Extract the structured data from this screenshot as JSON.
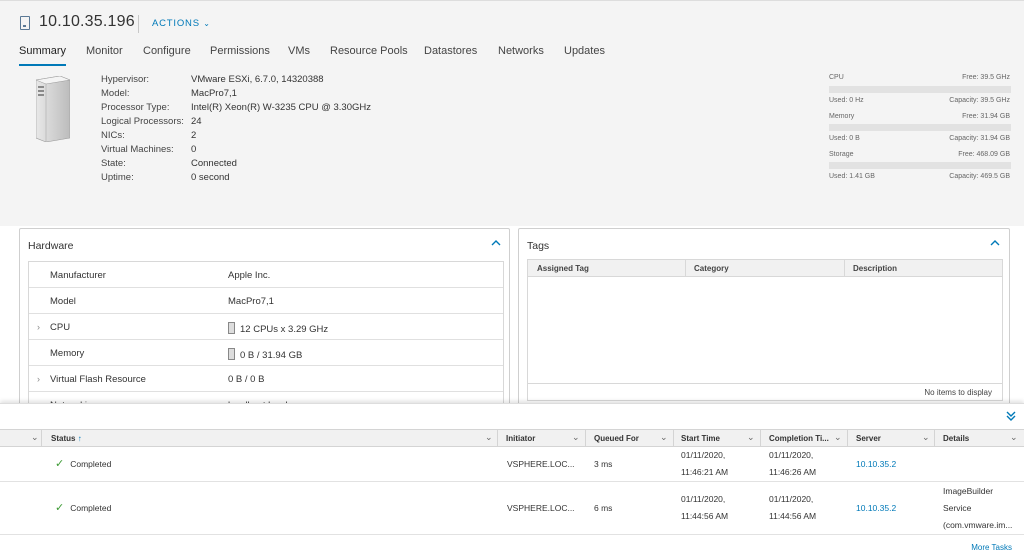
{
  "header": {
    "host_name": "10.10.35.196",
    "actions_label": "ACTIONS",
    "tabs": [
      "Summary",
      "Monitor",
      "Configure",
      "Permissions",
      "VMs",
      "Resource Pools",
      "Datastores",
      "Networks",
      "Updates"
    ],
    "active_tab": "Summary"
  },
  "summary": {
    "properties": [
      {
        "label": "Hypervisor:",
        "value": "VMware ESXi, 6.7.0, 14320388"
      },
      {
        "label": "Model:",
        "value": "MacPro7,1"
      },
      {
        "label": "Processor Type:",
        "value": "Intel(R) Xeon(R) W-3235 CPU @ 3.30GHz"
      },
      {
        "label": "Logical Processors:",
        "value": "24"
      },
      {
        "label": "NICs:",
        "value": "2"
      },
      {
        "label": "Virtual Machines:",
        "value": "0"
      },
      {
        "label": "State:",
        "value": "Connected"
      },
      {
        "label": "Uptime:",
        "value": "0 second"
      }
    ],
    "resources": [
      {
        "name": "CPU",
        "free": "Free: 39.5 GHz",
        "used": "Used: 0 Hz",
        "capacity": "Capacity: 39.5 GHz",
        "used_fraction": 0
      },
      {
        "name": "Memory",
        "free": "Free: 31.94 GB",
        "used": "Used: 0 B",
        "capacity": "Capacity: 31.94 GB",
        "used_fraction": 0
      },
      {
        "name": "Storage",
        "free": "Free: 468.09 GB",
        "used": "Used: 1.41 GB",
        "capacity": "Capacity: 469.5 GB",
        "used_fraction": 0.003
      }
    ]
  },
  "hardware": {
    "title": "Hardware",
    "rows": [
      {
        "key": "Manufacturer",
        "value": "Apple Inc."
      },
      {
        "key": "Model",
        "value": "MacPro7,1"
      },
      {
        "key": "CPU",
        "value": "12 CPUs x 3.29 GHz"
      },
      {
        "key": "Memory",
        "value": "0 B / 31.94 GB"
      },
      {
        "key": "Virtual Flash Resource",
        "value": "0 B / 0 B"
      },
      {
        "key": "Networking",
        "value": "localhost.local"
      }
    ]
  },
  "tags": {
    "title": "Tags",
    "columns": [
      "Assigned Tag",
      "Category",
      "Description"
    ],
    "empty_text": "No items to display"
  },
  "tasks": {
    "columns": [
      "Status",
      "Initiator",
      "Queued For",
      "Start Time",
      "Completion Ti...",
      "Server",
      "Details"
    ],
    "rows": [
      {
        "status": "Completed",
        "initiator": "VSPHERE.LOC...",
        "queued": "3 ms",
        "start": [
          "01/11/2020,",
          "11:46:21 AM"
        ],
        "completion": [
          "01/11/2020,",
          "11:46:26 AM"
        ],
        "server": "10.10.35.2",
        "details": []
      },
      {
        "status": "Completed",
        "initiator": "VSPHERE.LOC...",
        "queued": "6 ms",
        "start": [
          "01/11/2020,",
          "11:44:56 AM"
        ],
        "completion": [
          "01/11/2020,",
          "11:44:56 AM"
        ],
        "server": "10.10.35.2",
        "details": [
          "ImageBuilder",
          "Service",
          "(com.vmware.im..."
        ]
      }
    ],
    "more_tasks_label": "More Tasks"
  }
}
